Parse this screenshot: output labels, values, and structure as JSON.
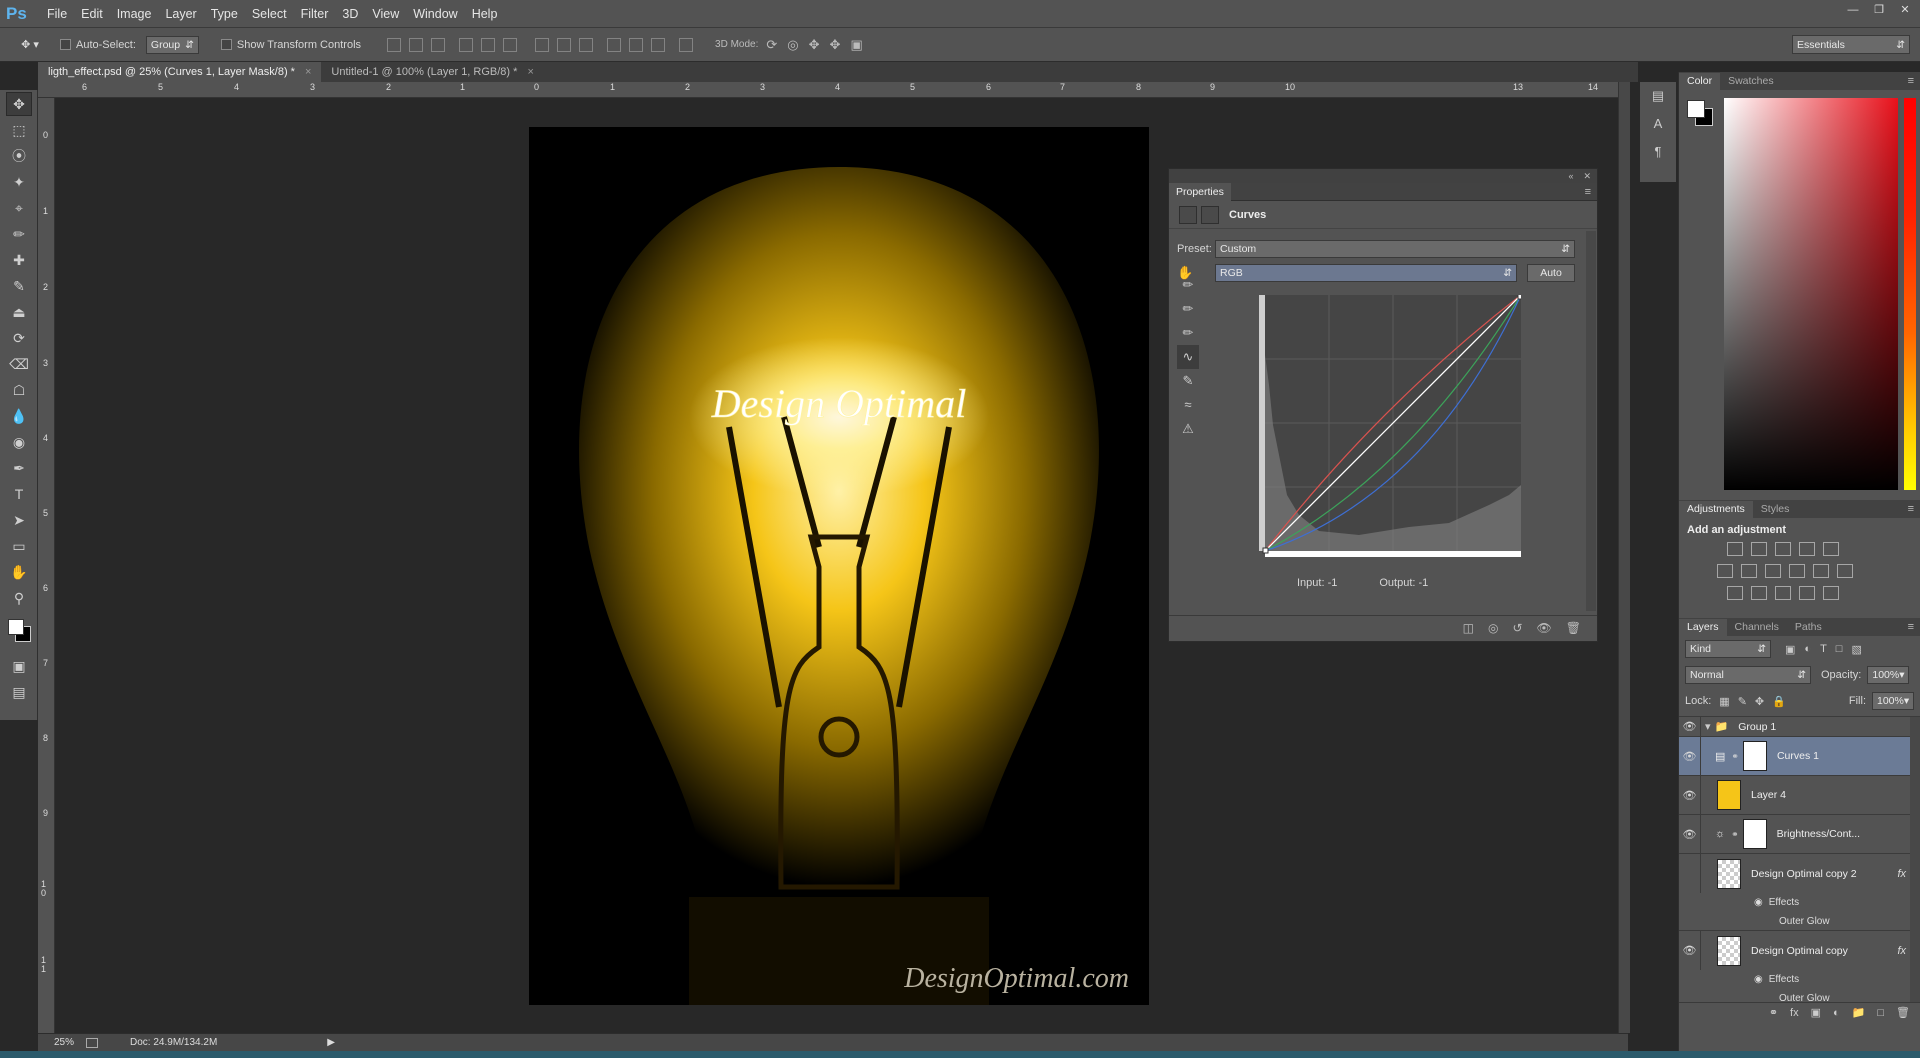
{
  "app": {
    "logo": "Ps"
  },
  "menu": [
    "File",
    "Edit",
    "Image",
    "Layer",
    "Type",
    "Select",
    "Filter",
    "3D",
    "View",
    "Window",
    "Help"
  ],
  "options": {
    "auto_select": "Auto-Select:",
    "group": "Group",
    "show_transform": "Show Transform Controls",
    "mode3d": "3D Mode:",
    "workspace": "Essentials"
  },
  "tabs": [
    {
      "label": "ligth_effect.psd @ 25% (Curves 1, Layer Mask/8) *"
    },
    {
      "label": "Untitled-1 @ 100% (Layer 1, RGB/8) *"
    }
  ],
  "ruler": {
    "top": [
      "6",
      "5",
      "4",
      "3",
      "2",
      "1",
      "0",
      "1",
      "2",
      "3",
      "4",
      "5",
      "6",
      "7",
      "8",
      "9",
      "10",
      "11",
      "12",
      "13",
      "14"
    ],
    "left": [
      "0",
      "1",
      "2",
      "3",
      "4",
      "5",
      "6",
      "7",
      "8",
      "9",
      "1 0",
      "1 1"
    ]
  },
  "image": {
    "glow_text": "Design Optimal",
    "watermark": "DesignOptimal.com"
  },
  "status": {
    "zoom": "25%",
    "doc": "Doc: 24.9M/134.2M"
  },
  "properties": {
    "title": "Properties",
    "type": "Curves",
    "preset_label": "Preset:",
    "preset": "Custom",
    "channel": "RGB",
    "auto": "Auto",
    "input": "Input: -1",
    "output": "Output: -1"
  },
  "color_panel": {
    "tabs": [
      "Color",
      "Swatches"
    ]
  },
  "adjustments": {
    "tabs": [
      "Adjustments",
      "Styles"
    ],
    "heading": "Add an adjustment"
  },
  "layers": {
    "tabs": [
      "Layers",
      "Channels",
      "Paths"
    ],
    "filter": "Kind",
    "blend": "Normal",
    "opacity_label": "Opacity:",
    "opacity": "100%",
    "lock_label": "Lock:",
    "fill_label": "Fill:",
    "fill": "100%",
    "group": "Group 1",
    "items": [
      "Curves 1",
      "Layer 4",
      "Brightness/Cont...",
      "Design Optimal copy 2",
      "Design Optimal copy"
    ],
    "effects": "Effects",
    "outer_glow": "Outer Glow",
    "fx": "fx"
  },
  "colors": {
    "accent": "#5eb4ee",
    "bulb": "#f5c518",
    "selected_layer": "#6b7b96"
  }
}
